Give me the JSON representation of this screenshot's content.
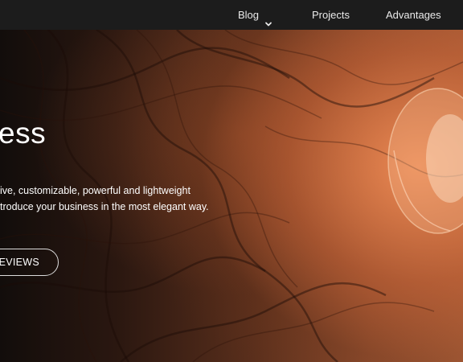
{
  "nav": {
    "items": [
      {
        "label": "Blog",
        "has_dropdown": true
      },
      {
        "label": "Projects"
      },
      {
        "label": "Advantages"
      }
    ]
  },
  "hero": {
    "title": "ess",
    "description_lines": [
      "ive, customizable, powerful and lightweight",
      "troduce your business in the most elegant way."
    ],
    "button_label": "REVIEWS"
  },
  "colors": {
    "nav_bg": "#1c1c1c",
    "nav_text": "#eaeaea",
    "hero_text": "#ffffff",
    "button_border": "#dcdcdc"
  }
}
